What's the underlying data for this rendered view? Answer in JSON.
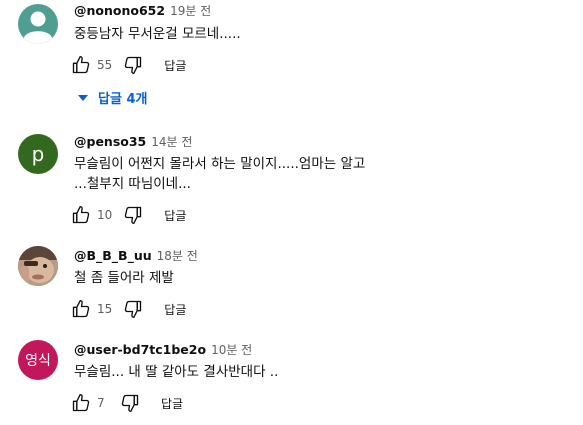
{
  "comments": [
    {
      "handle": "@nonono652",
      "time": "19분 전",
      "text_lines": [
        "중등남자 무서운걸 모르네....."
      ],
      "likes": "55",
      "reply_label": "답글",
      "avatar": {
        "type": "default-person",
        "color": "#4e9f92"
      },
      "replies_toggle": "답글 4개"
    },
    {
      "handle": "@penso35",
      "time": "14분 전",
      "text_lines": [
        "무슬림이 어쩐지 몰라서 하는 말이지.....엄마는 알고",
        "...철부지 따님이네..."
      ],
      "likes": "10",
      "reply_label": "답글",
      "avatar": {
        "type": "letter",
        "letter": "p",
        "color": "#33691e"
      }
    },
    {
      "handle": "@B_B_B_uu",
      "time": "18분 전",
      "text_lines": [
        "철 좀 들어라 제발"
      ],
      "likes": "15",
      "reply_label": "답글",
      "avatar": {
        "type": "photo"
      }
    },
    {
      "handle": "@user-bd7tc1be2o",
      "time": "10분 전",
      "text_lines": [
        "무슬림...  내 딸 같아도 결사반대다 .."
      ],
      "likes": "7",
      "reply_label": "답글",
      "avatar": {
        "type": "letter",
        "letter": "영식",
        "color": "#c2185b"
      }
    }
  ]
}
